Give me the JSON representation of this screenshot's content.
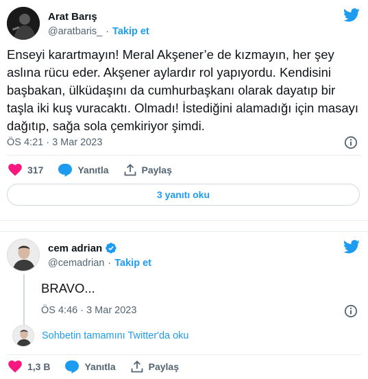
{
  "tweet1": {
    "author_name": "Arat Barış",
    "author_handle": "@aratbaris_",
    "dot": "·",
    "follow_label": "Takip et",
    "text": "Enseyi karartmayın! Meral Akşener’e de kızmayın, her şey aslına rücu eder. Akşener aylardır rol yapıyordu. Kendisini başbakan, ülküdaşını da cumhurbaşkanı olarak dayatıp bir taşla iki kuş vuracaktı. Olmadı! İstediğini alamadığı için masayı dağıtıp, sağa sola çemkiriyor şimdi.",
    "timestamp": "ÖS 4:21 · 3 Mar 2023",
    "like_count": "317",
    "reply_label": "Yanıtla",
    "share_label": "Paylaş",
    "read_replies_label": "3 yanıtı oku",
    "icons": [
      "twitter-bird-icon",
      "info-icon",
      "heart-icon",
      "reply-bubble-icon",
      "share-icon"
    ]
  },
  "tweet2": {
    "author_name": "cem adrian",
    "author_handle": "@cemadrian",
    "dot": "·",
    "follow_label": "Takip et",
    "text": "BRAVO...",
    "timestamp": "ÖS 4:46 · 3 Mar 2023",
    "conversation_link": "Sohbetin tamamını Twitter'da oku",
    "like_count": "1,3 B",
    "reply_label": "Yanıtla",
    "share_label": "Paylaş",
    "icons": [
      "verified-badge-icon",
      "twitter-bird-icon",
      "info-icon",
      "heart-icon",
      "reply-bubble-icon",
      "share-icon"
    ]
  },
  "colors": {
    "accent": "#1d9bf0",
    "like": "#f91880",
    "text": "#0f1419",
    "muted": "#536471",
    "border": "#e6ecf0"
  }
}
